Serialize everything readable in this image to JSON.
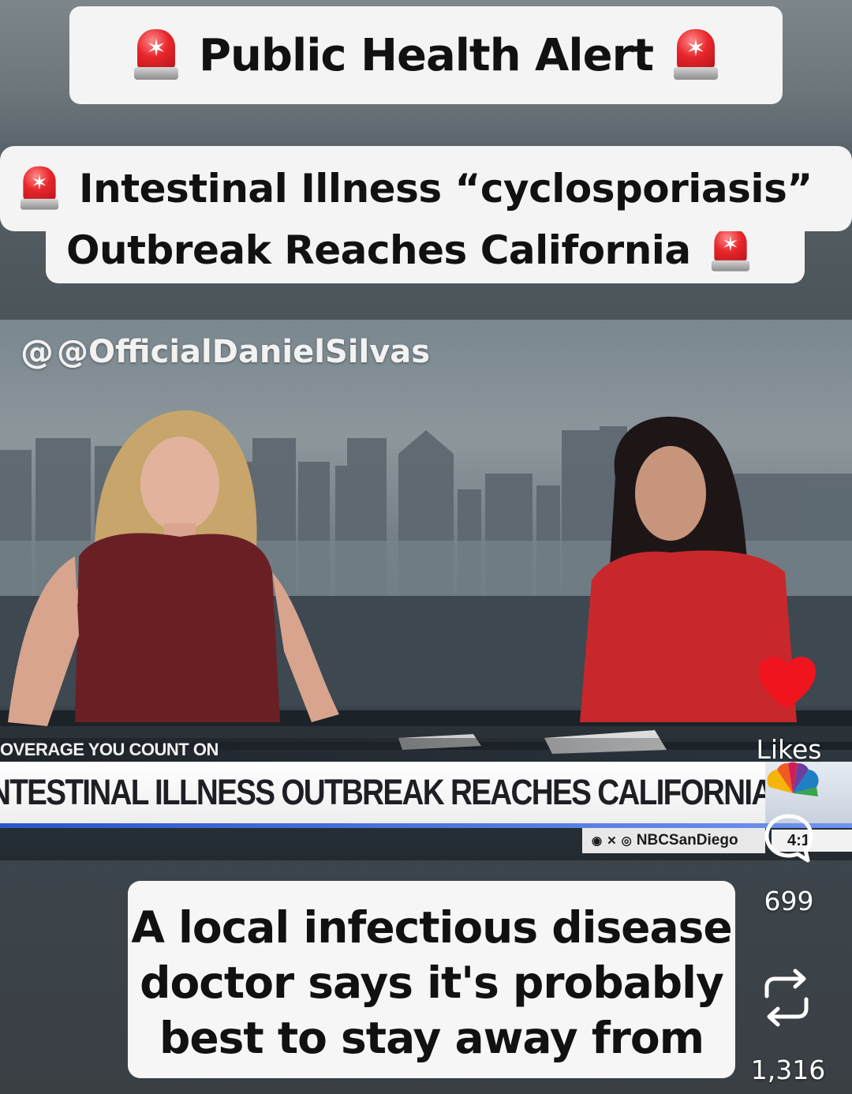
{
  "header": {
    "alert_title": "Public Health Alert",
    "headline_line_1": "Intestinal Illness “cyclosporiasis”",
    "headline_line_2": "Outbreak Reaches California",
    "emoji": "police-car-light-icon"
  },
  "video": {
    "watermark": "@OfficialDanielSilvas",
    "ticker_top": "OVERAGE YOU COUNT ON",
    "lower_third": "NTESTINAL ILLNESS OUTBREAK REACHES CALIFORNIA",
    "social_handle": "NBCSanDiego",
    "clock": "4:1"
  },
  "caption": {
    "text": "A local infectious disease doctor says it's probably best to stay away from"
  },
  "actions": {
    "likes_label": "Likes",
    "comment_count": "699",
    "repost_count": "1,316",
    "like_color": "#f0141e"
  }
}
